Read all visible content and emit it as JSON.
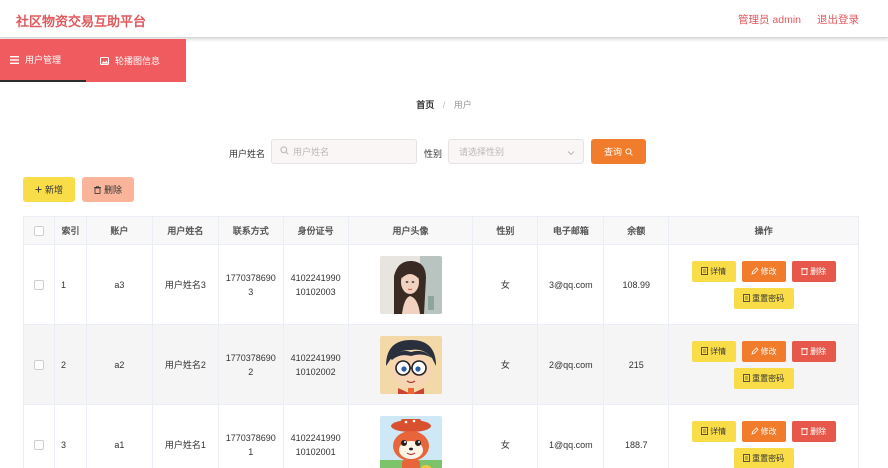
{
  "header": {
    "brand": "社区物资交易互助平台",
    "admin": "管理员 admin",
    "logout": "退出登录"
  },
  "nav": {
    "items": [
      {
        "label": "用户管理",
        "icon": "menu-icon"
      },
      {
        "label": "轮播图信息",
        "icon": "image-icon"
      }
    ]
  },
  "breadcrumb": {
    "home": "首页",
    "sep": "/",
    "current": "用户"
  },
  "search": {
    "name_label": "用户姓名",
    "name_placeholder": "用户姓名",
    "gender_label": "性别",
    "gender_placeholder": "请选择性别",
    "query_label": "查询"
  },
  "actions": {
    "add_label": "新增",
    "delete_label": "删除"
  },
  "table": {
    "headers": [
      "",
      "索引",
      "账户",
      "用户姓名",
      "联系方式",
      "身份证号",
      "用户头像",
      "性别",
      "电子邮箱",
      "余额",
      "操作"
    ],
    "op_labels": {
      "detail": "详情",
      "edit": "修改",
      "remove": "删除",
      "reset": "重置密码"
    },
    "rows": [
      {
        "index": "1",
        "account": "a3",
        "name": "用户姓名3",
        "phone": "17703786903",
        "idcard": "410224199010102003",
        "gender": "女",
        "email": "3@qq.com",
        "balance": "108.99",
        "avatar": "woman-portrait"
      },
      {
        "index": "2",
        "account": "a2",
        "name": "用户姓名2",
        "phone": "17703786902",
        "idcard": "410224199010102002",
        "gender": "女",
        "email": "2@qq.com",
        "balance": "215",
        "avatar": "cartoon-boy-glasses"
      },
      {
        "index": "3",
        "account": "a1",
        "name": "用户姓名1",
        "phone": "17703786901",
        "idcard": "410224199010102001",
        "gender": "女",
        "email": "1@qq.com",
        "balance": "188.7",
        "avatar": "cartoon-fox"
      }
    ]
  },
  "colors": {
    "brand": "#e05a5e",
    "nav_bg": "#ef5b5e",
    "query": "#f07c2c",
    "add": "#f9dd48",
    "delete": "#f9b49a",
    "remove": "#e6584a"
  }
}
